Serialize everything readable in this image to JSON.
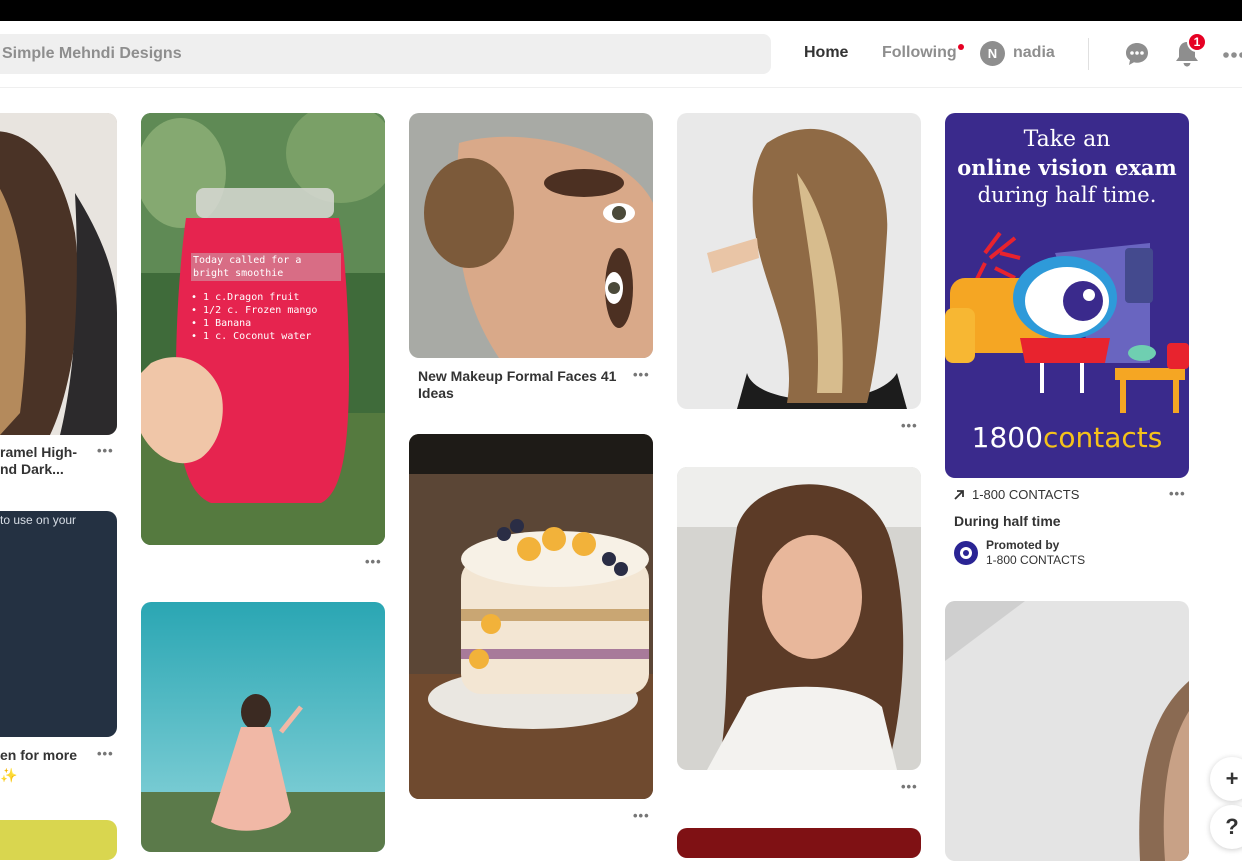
{
  "search": {
    "value": "Simple Mehndi Designs"
  },
  "nav": {
    "home": "Home",
    "following": "Following",
    "user_initial": "N",
    "user_name": "nadia",
    "notification_count": "1"
  },
  "pins": {
    "col1_caption": "ramel High-\nnd Dark...",
    "col1_card_text": "to use on your",
    "col1_caption2": "en for more",
    "col2_jar_title": "Today called for a bright smoothie",
    "col2_jar_items": [
      "• 1 c.Dragon fruit",
      "• 1/2 c. Frozen mango",
      "• 1 Banana",
      "• 1 c. Coconut water"
    ],
    "col3_caption": "New Makeup Formal Faces 41 Ideas",
    "ad_line1": "Take an",
    "ad_line2": "online vision exam",
    "ad_line3": "during half time.",
    "ad_brand_num": "1800",
    "ad_brand_word": "contacts",
    "ad_source": "1-800 CONTACTS",
    "ad_title": "During half time",
    "ad_promoted": "Promoted by",
    "ad_promoter": "1-800 CONTACTS"
  },
  "fab": {
    "plus": "+",
    "help": "?"
  }
}
